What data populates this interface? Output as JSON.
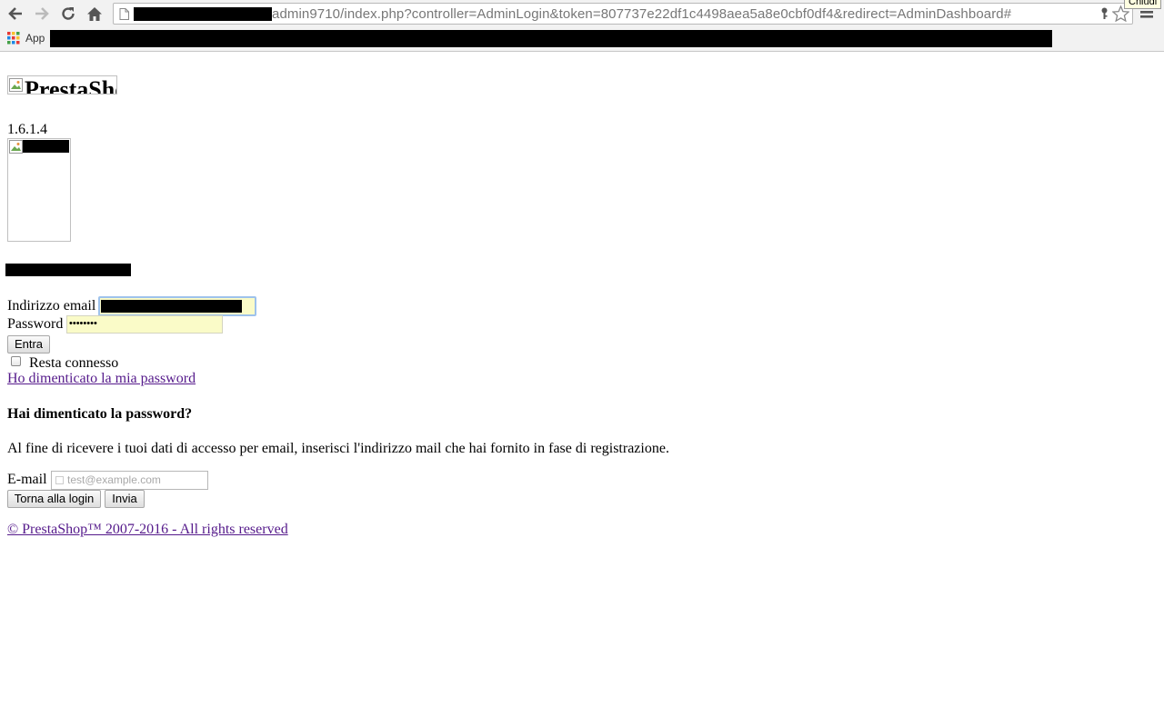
{
  "browser": {
    "url_text": "admin9710/index.php?controller=AdminLogin&token=807737e22df1c4498aea5a8e0cbf0df4&redirect=AdminDashboard#",
    "bookmarks_apps_label": "App",
    "tooltip": "Chiudi"
  },
  "page": {
    "logo_alt": "PrestaShop",
    "version": "1.6.1.4",
    "login": {
      "email_label": "Indirizzo email",
      "password_label": "Password",
      "password_value": "••••••••",
      "submit_label": "Entra",
      "remember_label": "Resta connesso",
      "forgot_link": "Ho dimenticato la mia password"
    },
    "forgot": {
      "heading": "Hai dimenticato la password?",
      "text": "Al fine di ricevere i tuoi dati di accesso per email, inserisci l'indirizzo mail che hai fornito in fase di registrazione.",
      "email_label": "E-mail",
      "email_placeholder": "test@example.com",
      "back_label": "Torna alla login",
      "send_label": "Invia"
    },
    "footer": {
      "copyright": "© PrestaShop™ 2007-2016 - All rights reserved"
    }
  }
}
